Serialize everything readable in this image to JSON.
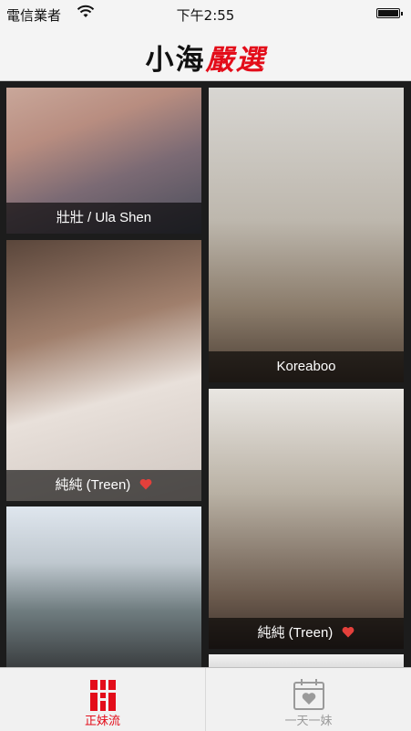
{
  "status_bar": {
    "carrier": "電信業者",
    "time": "下午2:55"
  },
  "header": {
    "title_part1": "小海",
    "title_part2": "嚴選",
    "accent_color": "#e30d1a"
  },
  "feed": {
    "cards": [
      {
        "caption": "壯壯 / Ula Shen",
        "heart": false
      },
      {
        "caption": "Koreaboo",
        "heart": false
      },
      {
        "caption": "純純 (Treen)",
        "heart": true
      },
      {
        "caption": "純純 (Treen)",
        "heart": true
      },
      {
        "caption": "",
        "heart": false
      },
      {
        "caption": "",
        "heart": false
      }
    ]
  },
  "tabbar": {
    "tabs": [
      {
        "label": "正妹流",
        "icon": "grid-bars-icon",
        "active": true
      },
      {
        "label": "一天一妹",
        "icon": "calendar-heart-icon",
        "active": false
      }
    ]
  }
}
